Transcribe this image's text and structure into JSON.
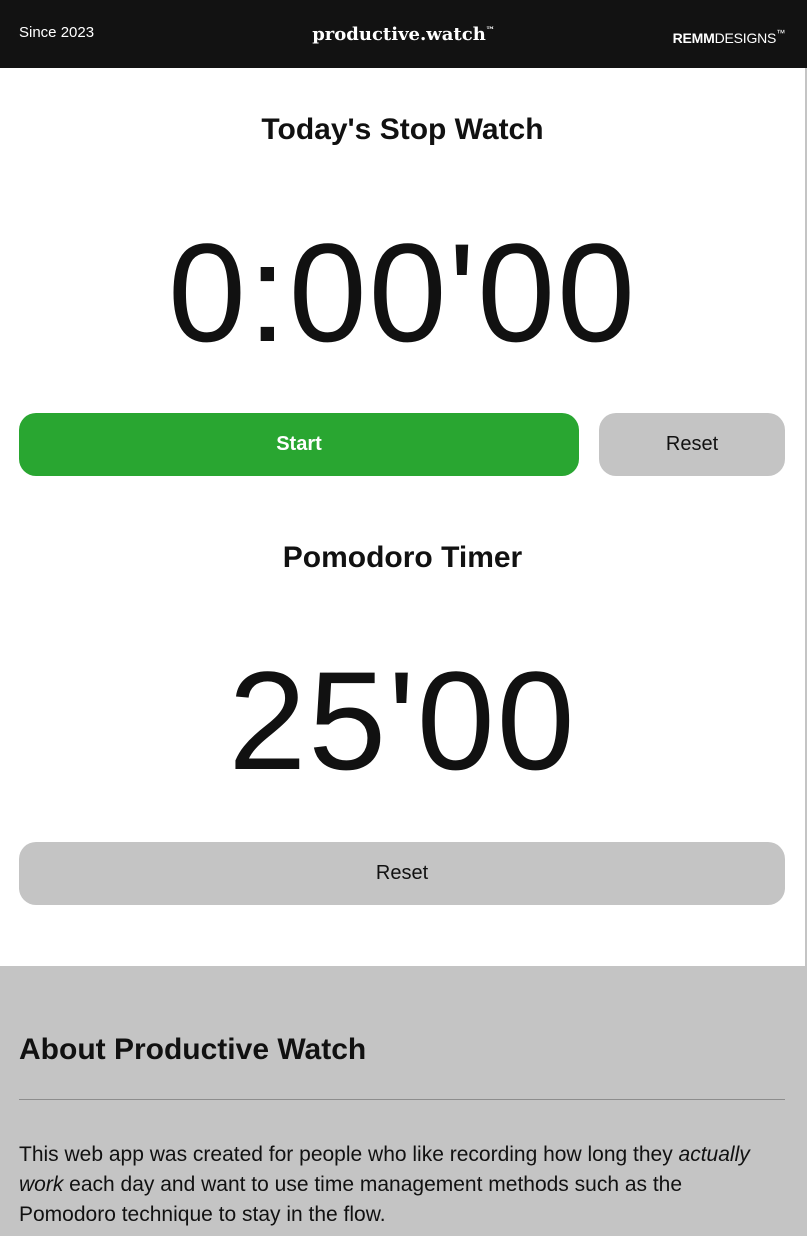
{
  "header": {
    "since": "Since 2023",
    "brand": "productive.watch",
    "brand_tm": "™",
    "designer_bold": "REMM",
    "designer_rest": "DESIGNS",
    "designer_tm": "™"
  },
  "stopwatch": {
    "title": "Today's Stop Watch",
    "display": "0:00'00",
    "start_label": "Start",
    "reset_label": "Reset"
  },
  "pomodoro": {
    "title": "Pomodoro Timer",
    "display": "25'00",
    "reset_label": "Reset"
  },
  "about": {
    "heading": "About Productive Watch",
    "text_before": "This web app was created for people who like recording how long they ",
    "text_emphasis": "actually work",
    "text_after": " each day and want to use time management methods such as the Pomodoro technique to stay in the flow."
  },
  "colors": {
    "header_bg": "#121212",
    "start_green": "#29a631",
    "button_gray": "#c4c4c4",
    "about_bg": "#c4c4c4"
  }
}
